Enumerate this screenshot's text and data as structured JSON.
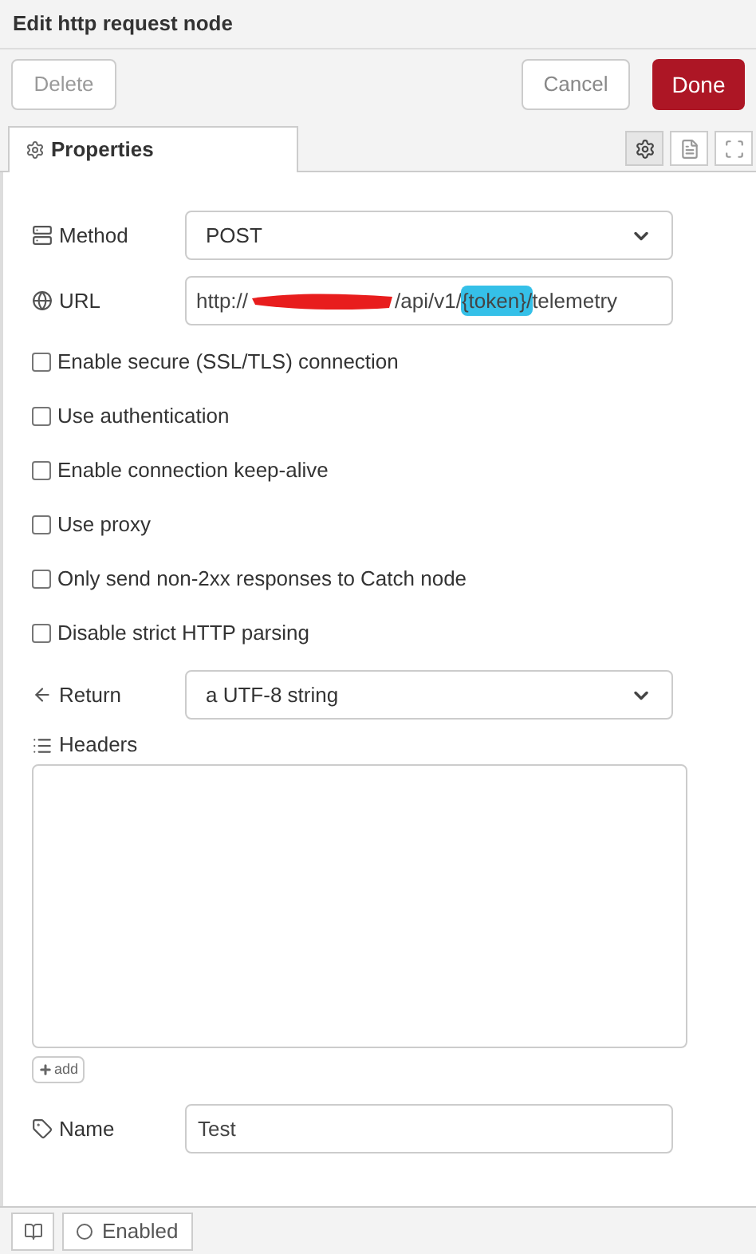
{
  "window": {
    "title": "Edit http request node"
  },
  "buttons": {
    "delete": "Delete",
    "cancel": "Cancel",
    "done": "Done"
  },
  "tabs": [
    {
      "label": "Properties",
      "selected": true
    }
  ],
  "tab_icons": [
    {
      "kind": "gear",
      "selected": true
    },
    {
      "kind": "document",
      "selected": false
    },
    {
      "kind": "frame",
      "selected": false
    }
  ],
  "method": {
    "label": "Method",
    "value": "POST"
  },
  "url": {
    "label": "URL",
    "parts": [
      {
        "kind": "plain",
        "text": "http://"
      },
      {
        "kind": "redacted"
      },
      {
        "kind": "plain",
        "text": "/api/v1/"
      },
      {
        "kind": "highlight",
        "text": "{token}/"
      },
      {
        "kind": "plain",
        "text": "telemetry"
      }
    ]
  },
  "options": [
    {
      "label": "Enable secure (SSL/TLS) connection",
      "checked": false
    },
    {
      "label": "Use authentication",
      "checked": false
    },
    {
      "label": "Enable connection keep-alive",
      "checked": false
    },
    {
      "label": "Use proxy",
      "checked": false
    },
    {
      "label": "Only send non-2xx responses to Catch node",
      "checked": false
    },
    {
      "label": "Disable strict HTTP parsing",
      "checked": false
    }
  ],
  "return": {
    "label": "Return",
    "value": "a UTF-8 string"
  },
  "headers": {
    "label": "Headers",
    "add_label": "add"
  },
  "name": {
    "label": "Name",
    "value": "Test"
  },
  "footer": {
    "status": "Enabled",
    "enabled": false
  }
}
